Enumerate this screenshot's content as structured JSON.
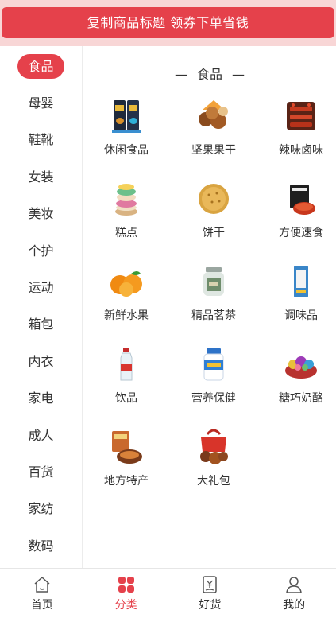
{
  "banner": {
    "text": "复制商品标题 领券下单省钱"
  },
  "sidebar": {
    "items": [
      {
        "label": "食品",
        "active": true
      },
      {
        "label": "母婴"
      },
      {
        "label": "鞋靴"
      },
      {
        "label": "女装"
      },
      {
        "label": "美妆"
      },
      {
        "label": "个护"
      },
      {
        "label": "运动"
      },
      {
        "label": "箱包"
      },
      {
        "label": "内衣"
      },
      {
        "label": "家电"
      },
      {
        "label": "成人"
      },
      {
        "label": "百货"
      },
      {
        "label": "家纺"
      },
      {
        "label": "数码"
      }
    ]
  },
  "content": {
    "section_title": "食品",
    "dash": "—",
    "categories": [
      {
        "label": "休闲食品",
        "icon": "snack-bags-icon"
      },
      {
        "label": "坚果果干",
        "icon": "nuts-icon"
      },
      {
        "label": "辣味卤味",
        "icon": "spicy-meat-icon"
      },
      {
        "label": "糕点",
        "icon": "macaron-icon"
      },
      {
        "label": "饼干",
        "icon": "biscuit-icon"
      },
      {
        "label": "方便速食",
        "icon": "instant-noodle-icon"
      },
      {
        "label": "新鲜水果",
        "icon": "orange-icon"
      },
      {
        "label": "精品茗茶",
        "icon": "tea-jar-icon"
      },
      {
        "label": "调味品",
        "icon": "seasoning-bag-icon"
      },
      {
        "label": "饮品",
        "icon": "water-bottle-icon"
      },
      {
        "label": "营养保健",
        "icon": "supplement-bottle-icon"
      },
      {
        "label": "糖巧奶酪",
        "icon": "candy-bowl-icon"
      },
      {
        "label": "地方特产",
        "icon": "local-specialty-icon"
      },
      {
        "label": "大礼包",
        "icon": "gift-bag-icon"
      }
    ]
  },
  "tabbar": {
    "tabs": [
      {
        "label": "首页",
        "icon": "home-icon"
      },
      {
        "label": "分类",
        "icon": "category-icon",
        "active": true
      },
      {
        "label": "好货",
        "icon": "yen-bag-icon"
      },
      {
        "label": "我的",
        "icon": "user-icon"
      }
    ]
  },
  "colors": {
    "accent": "#e5414b",
    "banner_bg": "#f8d6d6"
  }
}
